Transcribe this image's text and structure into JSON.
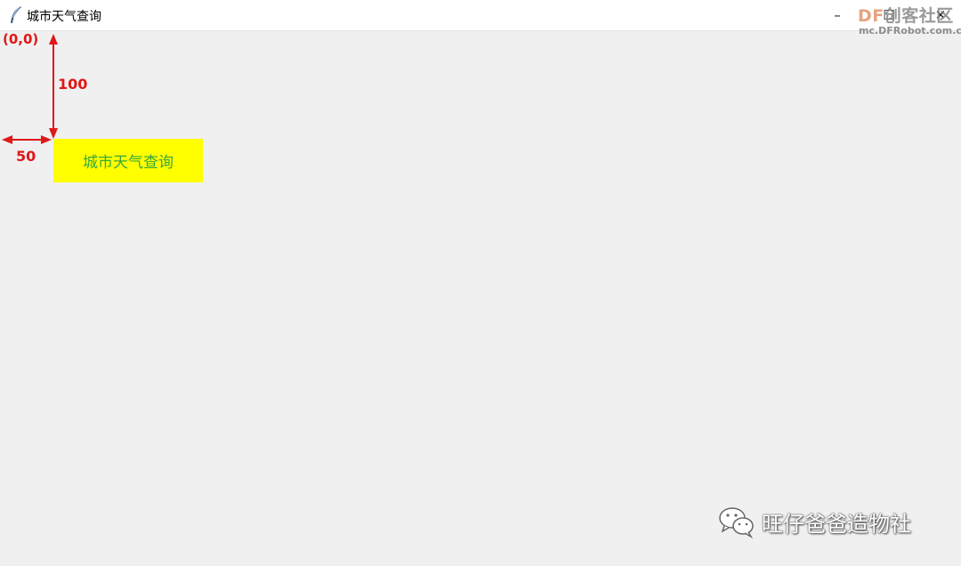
{
  "window": {
    "title": "城市天气查询",
    "controls": {
      "minimize_glyph": "–",
      "maximize_glyph": "☐",
      "close_glyph": "✕"
    },
    "app_icon": "feather-icon"
  },
  "overlay_logo": {
    "brand": "DF",
    "brand_sub": "创客社区",
    "url": "mc.DFRobot.com.cn"
  },
  "main": {
    "label_text": "城市天气查询",
    "label_bg": "#ffff00",
    "label_fg": "#3aa83a"
  },
  "annotations": {
    "origin": "(0,0)",
    "y_offset": "100",
    "x_offset": "50",
    "color": "#e01818"
  },
  "watermark": {
    "icon": "wechat-icon",
    "text": "旺仔爸爸造物社"
  }
}
